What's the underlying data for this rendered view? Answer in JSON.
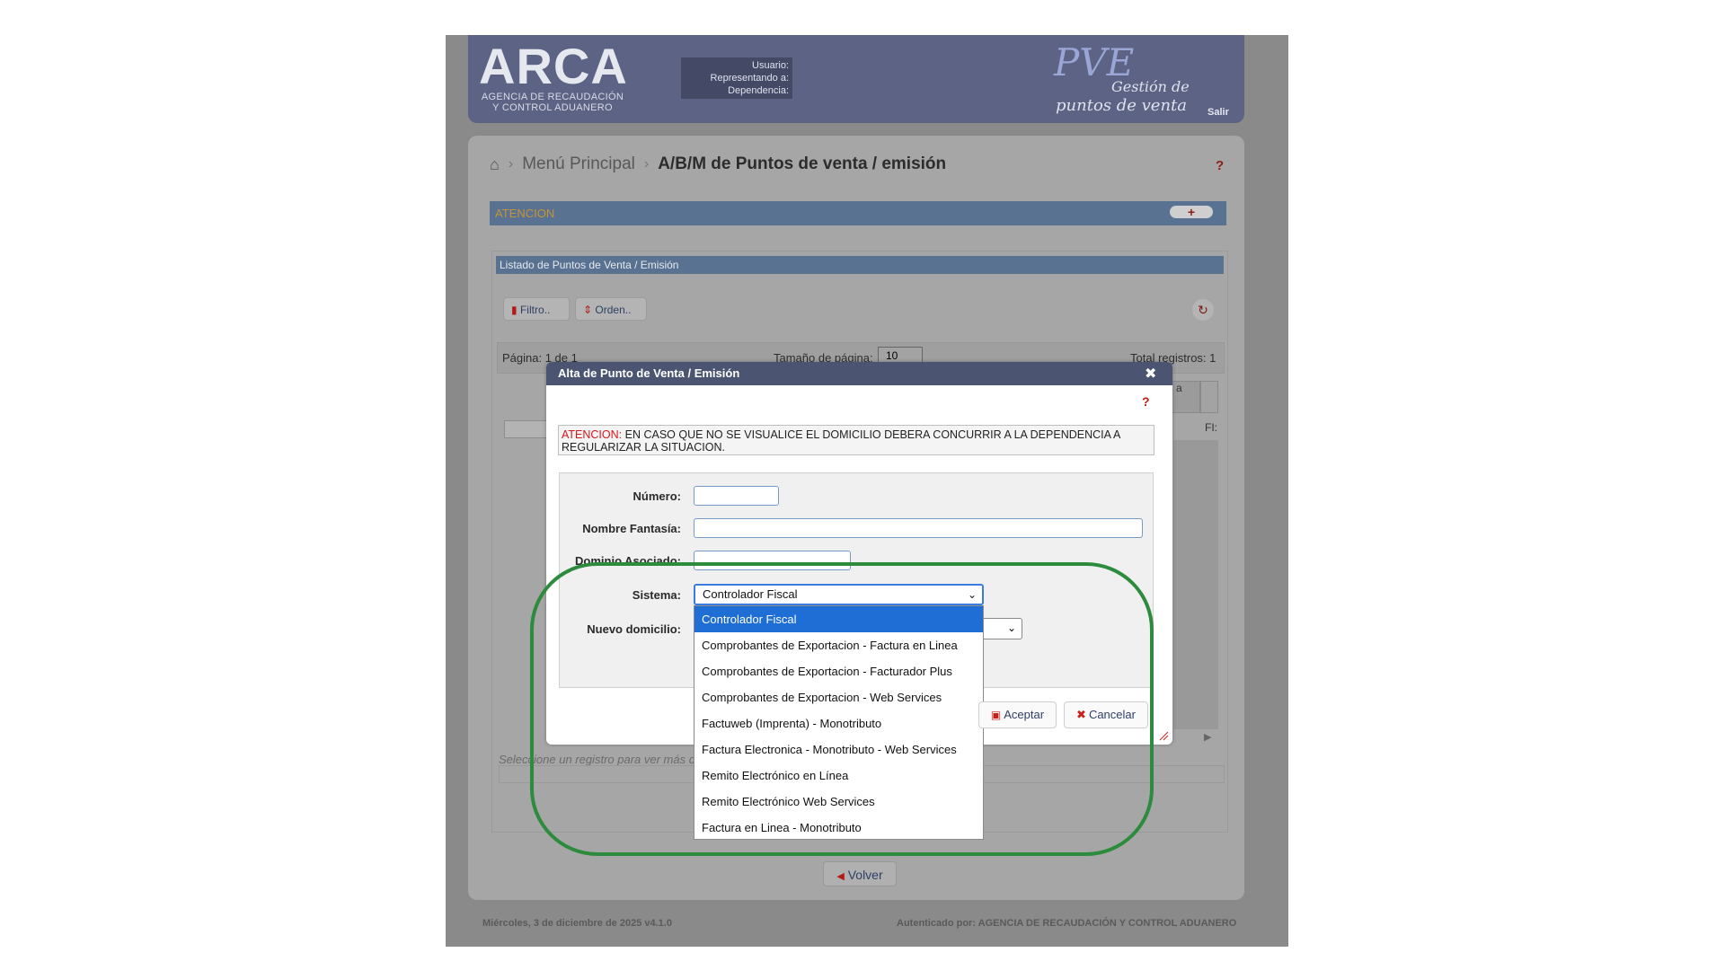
{
  "header": {
    "logo_title": "ARCA",
    "logo_subtitle_line1": "AGENCIA DE RECAUDACIÓN",
    "logo_subtitle_line2": "Y CONTROL ADUANERO",
    "user_label": "Usuario:",
    "representing_label": "Representando a:",
    "dependency_label": "Dependencia:",
    "app_logo": "PVE",
    "app_tagline_line1": "Gestión de",
    "app_tagline_line2": "puntos de venta",
    "logout": "Salir"
  },
  "breadcrumb": {
    "home_icon": "home-icon",
    "menu": "Menú Principal",
    "current": "A/B/M de Puntos de venta / emisión",
    "help": "?"
  },
  "atencion_bar": {
    "label": "ATENCION",
    "toggle": "+"
  },
  "list": {
    "title": "Listado de Puntos de Venta / Emisión",
    "filter_button": "Filtro..",
    "order_button": "Orden..",
    "page_label": "Página: 1 de 1",
    "page_size_label": "Tamaño de página:",
    "page_size_value": "10",
    "total_label": "Total registros: 1",
    "column_fragment": "a",
    "cell_fragment": "FI:",
    "select_hint": "Seleccione un registro para ver más d"
  },
  "volver": "Volver",
  "footer": {
    "left": "Miércoles, 3 de diciembre de 2025 v4.1.0",
    "right": "Autenticado por: AGENCIA DE RECAUDACIÓN Y CONTROL ADUANERO"
  },
  "modal": {
    "title": "Alta de Punto de Venta / Emisión",
    "close": "✖",
    "help": "?",
    "alert_prefix": "ATENCION:",
    "alert_text": " EN CASO QUE NO SE VISUALICE EL DOMICILIO DEBERA CONCURRIR A LA DEPENDENCIA A REGULARIZAR LA SITUACION.",
    "fields": {
      "numero_label": "Número:",
      "numero_value": "",
      "nombre_label": "Nombre Fantasía:",
      "nombre_value": "",
      "dominio_label": "Dominio Asociado:",
      "dominio_value": "",
      "sistema_label": "Sistema:",
      "sistema_value": "Controlador Fiscal",
      "domicilio_label": "Nuevo domicilio:"
    },
    "sistema_options": [
      "Controlador Fiscal",
      "Comprobantes de Exportacion - Factura en Linea",
      "Comprobantes de Exportacion - Facturador Plus",
      "Comprobantes de Exportacion - Web Services",
      "Factuweb (Imprenta) - Monotributo",
      "Factura Electronica - Monotributo - Web Services",
      "Remito Electrónico en Línea",
      "Remito Electrónico Web Services",
      "Factura en Linea - Monotributo"
    ],
    "accept": "Aceptar",
    "cancel": "Cancelar"
  },
  "colors": {
    "header_bg": "#5d6384",
    "bar_bg": "#5a7291",
    "selected_option": "#1e6ed6",
    "highlight": "#2c8b3c",
    "alert_red": "#d4181d"
  }
}
